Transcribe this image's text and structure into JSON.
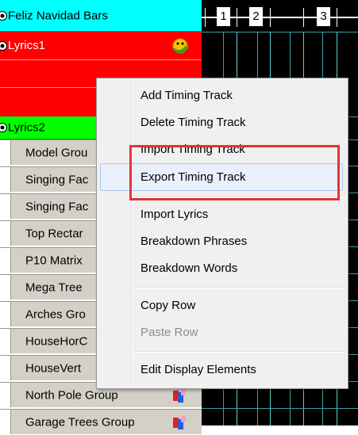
{
  "rows": {
    "timing_track_1": "Feliz Navidad Bars",
    "timing_track_2": "Lyrics1",
    "timing_track_3": "Lyrics2"
  },
  "models": [
    "Model Grou",
    "Singing Fac",
    "Singing Fac",
    "Top Rectar",
    "P10 Matrix",
    "Mega Tree",
    "Arches Gro",
    "HouseHorC",
    "HouseVert",
    "North Pole Group",
    "Garage Trees Group"
  ],
  "ruler": {
    "labels": [
      "1",
      "2",
      "3"
    ]
  },
  "context_menu": {
    "items": [
      "Add Timing Track",
      "Delete Timing Track",
      "Import Timing Track",
      "Export Timing Track",
      "Import Lyrics",
      "Breakdown Phrases",
      "Breakdown Words",
      "Copy Row",
      "Paste Row",
      "Edit Display Elements"
    ],
    "highlighted": "Export Timing Track",
    "disabled": [
      "Paste Row"
    ]
  },
  "colors": {
    "timing_track_1": "#00ffff",
    "timing_track_2": "#ff0000",
    "timing_track_3": "#00ff00",
    "model_row": "#d4d0c8",
    "grid_background": "#000000",
    "grid_lines": "#3aa0a0",
    "annotation_box": "#e53333"
  },
  "icons": {
    "expand_marker": "circle-toggle-icon",
    "lyrics_icon": "lyrics-face-icon",
    "model_group_icon": "model-group-icon"
  }
}
